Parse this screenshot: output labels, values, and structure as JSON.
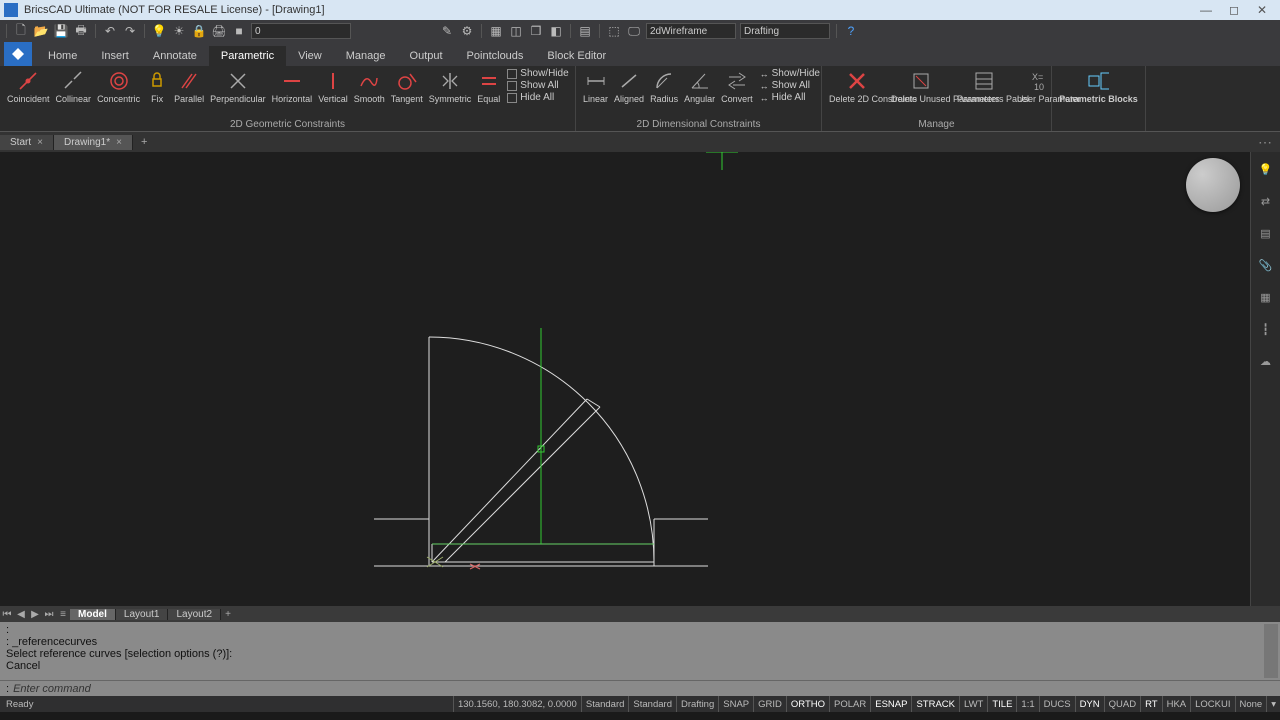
{
  "title": "BricsCAD Ultimate (NOT FOR RESALE License) - [Drawing1]",
  "qat": {
    "layer_value": "0",
    "visual_style": "2dWireframe",
    "workspace": "Drafting"
  },
  "tabs": [
    "Home",
    "Insert",
    "Annotate",
    "Parametric",
    "View",
    "Manage",
    "Output",
    "Pointclouds",
    "Block Editor"
  ],
  "active_tab": "Parametric",
  "panels": {
    "geo": {
      "title": "2D Geometric Constraints",
      "items": [
        "Coincident",
        "Collinear",
        "Concentric",
        "Fix",
        "Parallel",
        "Perpendicular",
        "Horizontal",
        "Vertical",
        "Smooth",
        "Tangent",
        "Symmetric",
        "Equal"
      ],
      "toggles": [
        "Show/Hide",
        "Show All",
        "Hide All"
      ]
    },
    "dim": {
      "title": "2D Dimensional Constraints",
      "items": [
        "Linear",
        "Aligned",
        "Radius",
        "Angular",
        "Convert"
      ],
      "toggles": [
        "Show/Hide",
        "Show All",
        "Hide All"
      ]
    },
    "manage": {
      "title": "Manage",
      "items": [
        "Delete 2D Constraints",
        "Delete Unused Parameters",
        "Parameters Panel",
        "User Parameter"
      ]
    },
    "pblocks": {
      "title": "Parametric Blocks"
    }
  },
  "doctabs": {
    "start": "Start",
    "drawing": "Drawing1*"
  },
  "layouts": {
    "model": "Model",
    "l1": "Layout1",
    "l2": "Layout2"
  },
  "cmd": {
    "l1": ":",
    "l2": ": _referencecurves",
    "l3": "Select reference curves [selection options (?)]:",
    "l4": "Cancel",
    "prompt": ":",
    "placeholder": "Enter command"
  },
  "status": {
    "ready": "Ready",
    "coords": "130.1560, 180.3082, 0.0000",
    "std1": "Standard",
    "std2": "Standard",
    "style": "Drafting",
    "toggles": [
      "SNAP",
      "GRID",
      "ORTHO",
      "POLAR",
      "ESNAP",
      "STRACK",
      "LWT",
      "TILE",
      "1:1",
      "DUCS",
      "DYN",
      "QUAD",
      "RT",
      "HKA",
      "LOCKUI",
      "None"
    ],
    "toggles_on": [
      false,
      false,
      true,
      false,
      true,
      true,
      false,
      true,
      false,
      false,
      true,
      false,
      true,
      false,
      false,
      false
    ]
  }
}
